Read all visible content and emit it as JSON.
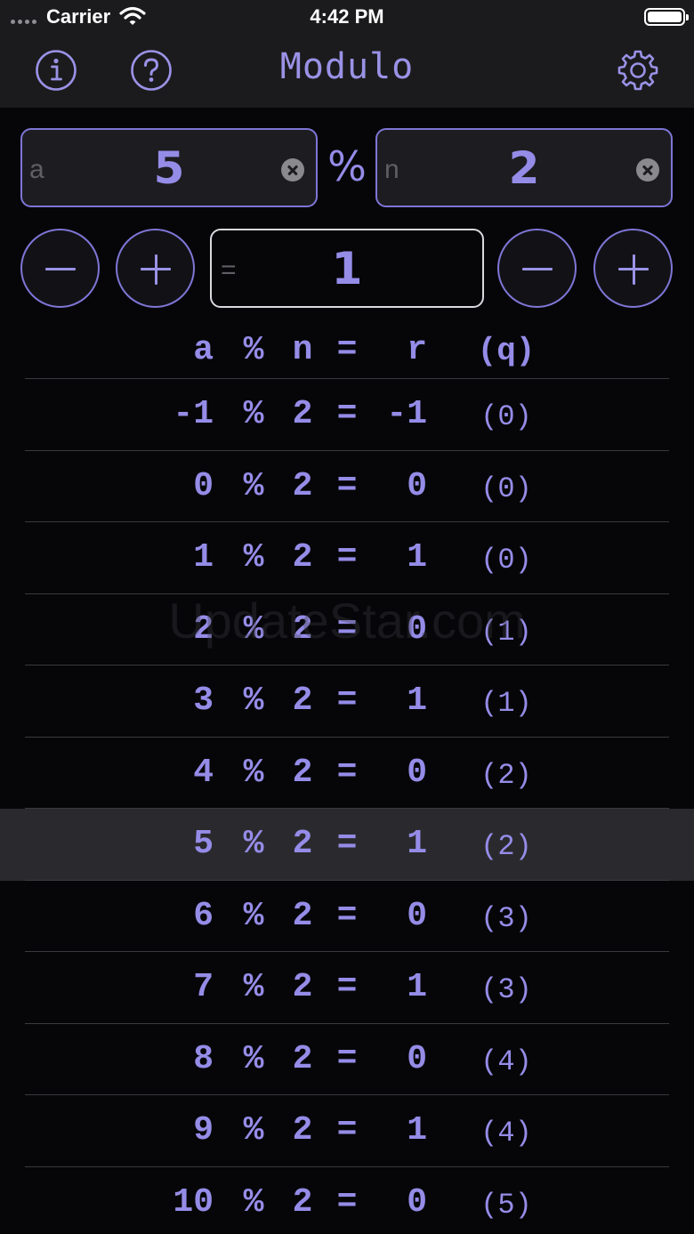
{
  "status_bar": {
    "carrier": "Carrier",
    "time": "4:42 PM"
  },
  "nav": {
    "title": "Modulo",
    "icons": [
      "info-icon",
      "help-icon",
      "settings-icon"
    ]
  },
  "inputs": {
    "a": {
      "placeholder": "a",
      "value": "5"
    },
    "operator": "%",
    "n": {
      "placeholder": "n",
      "value": "2"
    }
  },
  "result": {
    "placeholder": "=",
    "value": "1"
  },
  "table": {
    "header": {
      "a": "a",
      "op": "%",
      "n": "n",
      "eq": "=",
      "r": "r",
      "q": "(q)"
    },
    "rows": [
      {
        "a": "-1",
        "op": "%",
        "n": "2",
        "eq": "=",
        "r": "-1",
        "q": "(0)"
      },
      {
        "a": "0",
        "op": "%",
        "n": "2",
        "eq": "=",
        "r": "0",
        "q": "(0)"
      },
      {
        "a": "1",
        "op": "%",
        "n": "2",
        "eq": "=",
        "r": "1",
        "q": "(0)"
      },
      {
        "a": "2",
        "op": "%",
        "n": "2",
        "eq": "=",
        "r": "0",
        "q": "(1)"
      },
      {
        "a": "3",
        "op": "%",
        "n": "2",
        "eq": "=",
        "r": "1",
        "q": "(1)"
      },
      {
        "a": "4",
        "op": "%",
        "n": "2",
        "eq": "=",
        "r": "0",
        "q": "(2)"
      },
      {
        "a": "5",
        "op": "%",
        "n": "2",
        "eq": "=",
        "r": "1",
        "q": "(2)",
        "selected": true
      },
      {
        "a": "6",
        "op": "%",
        "n": "2",
        "eq": "=",
        "r": "0",
        "q": "(3)"
      },
      {
        "a": "7",
        "op": "%",
        "n": "2",
        "eq": "=",
        "r": "1",
        "q": "(3)"
      },
      {
        "a": "8",
        "op": "%",
        "n": "2",
        "eq": "=",
        "r": "0",
        "q": "(4)"
      },
      {
        "a": "9",
        "op": "%",
        "n": "2",
        "eq": "=",
        "r": "1",
        "q": "(4)"
      },
      {
        "a": "10",
        "op": "%",
        "n": "2",
        "eq": "=",
        "r": "0",
        "q": "(5)"
      }
    ]
  },
  "watermark": "UpdateStar.com",
  "colors": {
    "accent": "#958ce8",
    "background": "#060608",
    "bar": "#1b1b1d",
    "selected_row": "#2a2a2e"
  }
}
